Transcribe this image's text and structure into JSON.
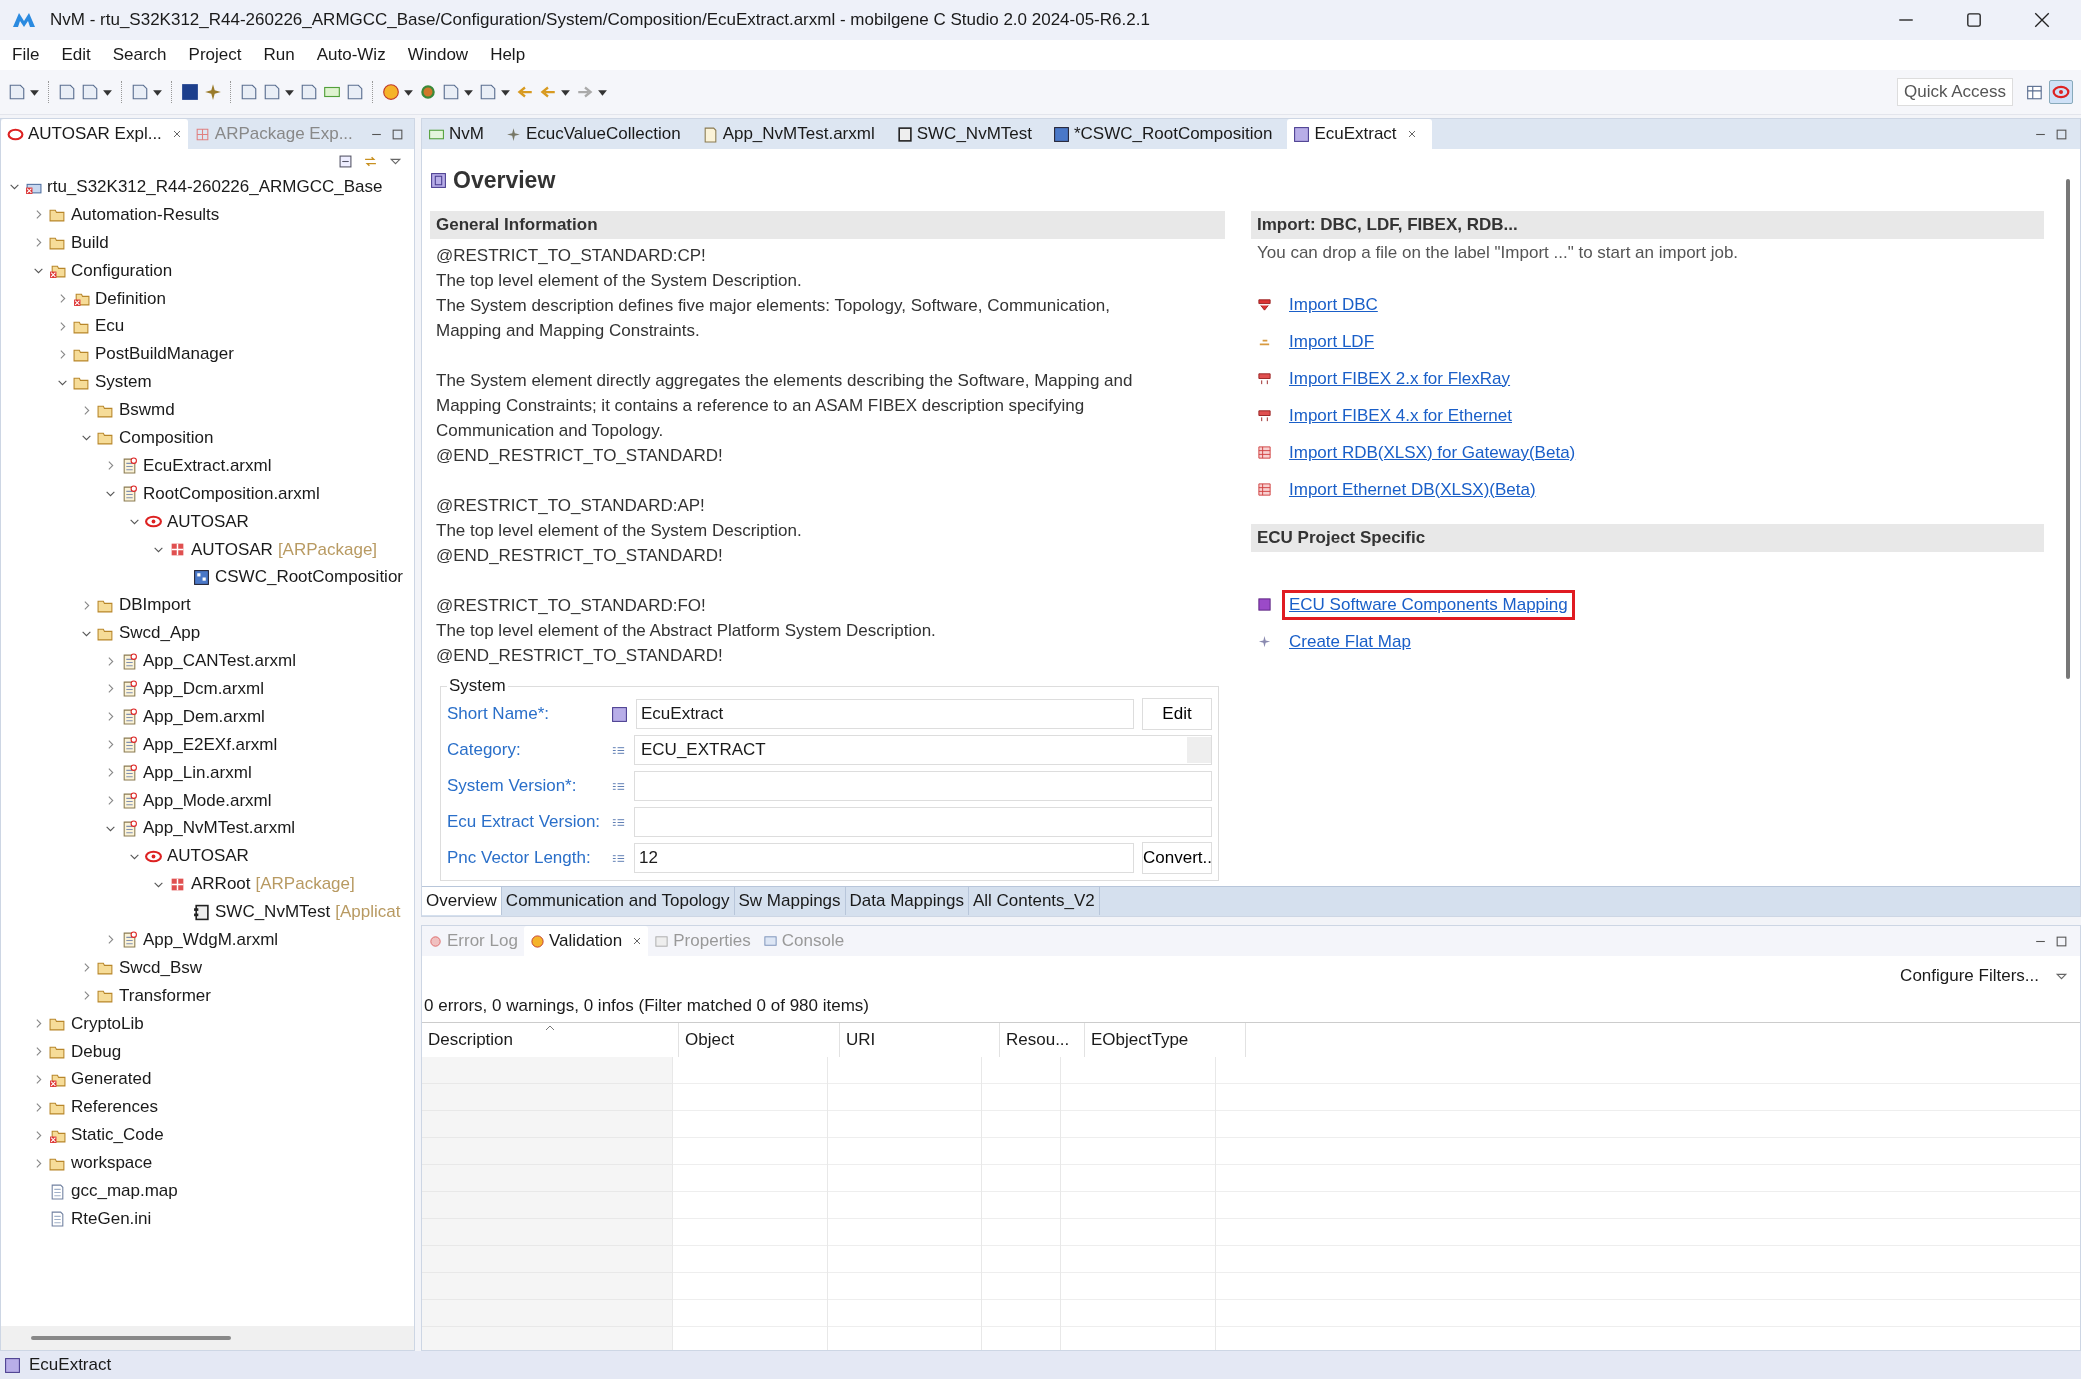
{
  "window": {
    "title": "NvM - rtu_S32K312_R44-260226_ARMGCC_Base/Configuration/System/Composition/EcuExtract.arxml - mobilgene C Studio 2.0 2024-05-R6.2.1"
  },
  "menu": [
    "File",
    "Edit",
    "Search",
    "Project",
    "Run",
    "Auto-Wiz",
    "Window",
    "Help"
  ],
  "toolbar": {
    "quick_access": "Quick Access"
  },
  "left_panel": {
    "tabs": [
      {
        "label": "AUTOSAR Expl...",
        "selected": true
      },
      {
        "label": "ARPackage Exp...",
        "selected": false
      }
    ],
    "tree": [
      {
        "label": "rtu_S32K312_R44-260226_ARMGCC_Base",
        "kind": "project",
        "expanded": true,
        "children": [
          {
            "label": "Automation-Results",
            "kind": "folder",
            "expanded": false
          },
          {
            "label": "Build",
            "kind": "folder",
            "expanded": false
          },
          {
            "label": "Configuration",
            "kind": "folder-error",
            "expanded": true,
            "children": [
              {
                "label": "Definition",
                "kind": "folder-error",
                "expanded": false
              },
              {
                "label": "Ecu",
                "kind": "folder",
                "expanded": false
              },
              {
                "label": "PostBuildManager",
                "kind": "folder",
                "expanded": false
              },
              {
                "label": "System",
                "kind": "folder",
                "expanded": true,
                "children": [
                  {
                    "label": "Bswmd",
                    "kind": "folder",
                    "expanded": false
                  },
                  {
                    "label": "Composition",
                    "kind": "folder",
                    "expanded": true,
                    "children": [
                      {
                        "label": "EcuExtract.arxml",
                        "kind": "arxml",
                        "expanded": false
                      },
                      {
                        "label": "RootComposition.arxml",
                        "kind": "arxml",
                        "expanded": true,
                        "children": [
                          {
                            "label": "AUTOSAR",
                            "kind": "autosar",
                            "expanded": true,
                            "children": [
                              {
                                "label": "AUTOSAR",
                                "suffix": "[ARPackage]",
                                "kind": "package",
                                "expanded": true,
                                "children": [
                                  {
                                    "label": "CSWC_RootCompositior",
                                    "kind": "composition"
                                  }
                                ]
                              }
                            ]
                          }
                        ]
                      }
                    ]
                  },
                  {
                    "label": "DBImport",
                    "kind": "folder",
                    "expanded": false
                  },
                  {
                    "label": "Swcd_App",
                    "kind": "folder",
                    "expanded": true,
                    "children": [
                      {
                        "label": "App_CANTest.arxml",
                        "kind": "arxml",
                        "expanded": false
                      },
                      {
                        "label": "App_Dcm.arxml",
                        "kind": "arxml",
                        "expanded": false
                      },
                      {
                        "label": "App_Dem.arxml",
                        "kind": "arxml",
                        "expanded": false
                      },
                      {
                        "label": "App_E2EXf.arxml",
                        "kind": "arxml",
                        "expanded": false
                      },
                      {
                        "label": "App_Lin.arxml",
                        "kind": "arxml",
                        "expanded": false
                      },
                      {
                        "label": "App_Mode.arxml",
                        "kind": "arxml",
                        "expanded": false
                      },
                      {
                        "label": "App_NvMTest.arxml",
                        "kind": "arxml",
                        "expanded": true,
                        "children": [
                          {
                            "label": "AUTOSAR",
                            "kind": "autosar",
                            "expanded": true,
                            "children": [
                              {
                                "label": "ARRoot",
                                "suffix": "[ARPackage]",
                                "kind": "package",
                                "expanded": true,
                                "children": [
                                  {
                                    "label": "SWC_NvMTest",
                                    "suffix": "[Applicat",
                                    "kind": "swc"
                                  }
                                ]
                              }
                            ]
                          }
                        ]
                      },
                      {
                        "label": "App_WdgM.arxml",
                        "kind": "arxml",
                        "expanded": false
                      }
                    ]
                  },
                  {
                    "label": "Swcd_Bsw",
                    "kind": "folder",
                    "expanded": false
                  },
                  {
                    "label": "Transformer",
                    "kind": "folder",
                    "expanded": false
                  }
                ]
              }
            ]
          },
          {
            "label": "CryptoLib",
            "kind": "folder",
            "expanded": false
          },
          {
            "label": "Debug",
            "kind": "folder",
            "expanded": false
          },
          {
            "label": "Generated",
            "kind": "folder-error",
            "expanded": false
          },
          {
            "label": "References",
            "kind": "folder",
            "expanded": false
          },
          {
            "label": "Static_Code",
            "kind": "folder-error",
            "expanded": false
          },
          {
            "label": "workspace",
            "kind": "folder",
            "expanded": false
          },
          {
            "label": "gcc_map.map",
            "kind": "file"
          },
          {
            "label": "RteGen.ini",
            "kind": "file"
          }
        ]
      }
    ]
  },
  "editor_tabs": [
    {
      "label": "NvM",
      "kind": "module",
      "selected": false
    },
    {
      "label": "EcucValueCollection",
      "kind": "collection",
      "selected": false
    },
    {
      "label": "App_NvMTest.arxml",
      "kind": "arxml",
      "selected": false
    },
    {
      "label": "SWC_NvMTest",
      "kind": "swc",
      "selected": false
    },
    {
      "label": "*CSWC_RootComposition",
      "kind": "composition",
      "selected": false
    },
    {
      "label": "EcuExtract",
      "kind": "extract",
      "selected": true
    }
  ],
  "overview": {
    "title": "Overview",
    "general_information": {
      "heading": "General Information",
      "paragraphs": [
        [
          "@RESTRICT_TO_STANDARD:CP!",
          "The top level element of the System Description.",
          "The System description defines five major elements: Topology, Software, Communication,",
          "Mapping and Mapping Constraints."
        ],
        [
          "The System element directly aggregates the elements describing the Software, Mapping and",
          "Mapping Constraints; it contains a reference to an ASAM FIBEX description specifying",
          "Communication and Topology.",
          "@END_RESTRICT_TO_STANDARD!"
        ],
        [
          "@RESTRICT_TO_STANDARD:AP!",
          "The top level element of the System Description.",
          "@END_RESTRICT_TO_STANDARD!"
        ],
        [
          "@RESTRICT_TO_STANDARD:FO!",
          "The top level element of the Abstract Platform System Description.",
          "@END_RESTRICT_TO_STANDARD!"
        ]
      ]
    },
    "system": {
      "legend": "System",
      "fields": [
        {
          "label": "Short Name*:",
          "kind": "name",
          "value": "EcuExtract",
          "button": "Edit"
        },
        {
          "label": "Category:",
          "kind": "combo",
          "value": "ECU_EXTRACT"
        },
        {
          "label": "System Version*:",
          "kind": "text"
        },
        {
          "label": "Ecu Extract Version:",
          "kind": "text"
        },
        {
          "label": "Pnc Vector Length:",
          "kind": "text",
          "value": "12",
          "button": "Convert.."
        }
      ]
    },
    "import": {
      "heading": "Import: DBC, LDF, FIBEX, RDB...",
      "hint": "You can drop a file on the label \"Import ...\" to start an import job.",
      "links": [
        {
          "label": "Import DBC",
          "kind": "dbc"
        },
        {
          "label": "Import LDF",
          "kind": "ldf"
        },
        {
          "label": "Import FIBEX 2.x for FlexRay",
          "kind": "fibex"
        },
        {
          "label": "Import FIBEX 4.x for Ethernet",
          "kind": "fibex"
        },
        {
          "label": "Import RDB(XLSX) for Gateway(Beta)",
          "kind": "sheet"
        },
        {
          "label": "Import Ethernet DB(XLSX)(Beta)",
          "kind": "sheet"
        }
      ]
    },
    "ecu_project_specific": {
      "heading": "ECU Project Specific",
      "links": [
        {
          "label": "ECU Software Components Mapping",
          "kind": "mapping",
          "highlighted": true
        },
        {
          "label": "Create Flat Map",
          "kind": "flatmap",
          "highlighted": false
        }
      ]
    }
  },
  "page_tabs": [
    {
      "label": "Overview",
      "selected": true
    },
    {
      "label": "Communication and Topology",
      "selected": false
    },
    {
      "label": "Sw Mappings",
      "selected": false
    },
    {
      "label": "Data Mappings",
      "selected": false
    },
    {
      "label": "All Contents_V2",
      "selected": false
    }
  ],
  "bottom_panel": {
    "tabs": [
      {
        "label": "Error Log",
        "kind": "errorlog",
        "selected": false
      },
      {
        "label": "Validation",
        "kind": "validation",
        "selected": true
      },
      {
        "label": "Properties",
        "kind": "properties",
        "selected": false
      },
      {
        "label": "Console",
        "kind": "console",
        "selected": false
      }
    ],
    "configure_filters": "Configure Filters...",
    "summary": "0 errors, 0 warnings, 0 infos (Filter matched 0 of 980 items)",
    "table": {
      "columns": [
        {
          "label": "Description",
          "sorted": true
        },
        {
          "label": "Object",
          "sorted": false
        },
        {
          "label": "URI",
          "sorted": false
        },
        {
          "label": "Resou...",
          "sorted": false
        },
        {
          "label": "EObjectType",
          "sorted": false
        }
      ]
    }
  },
  "status_bar": {
    "text": "EcuExtract"
  }
}
